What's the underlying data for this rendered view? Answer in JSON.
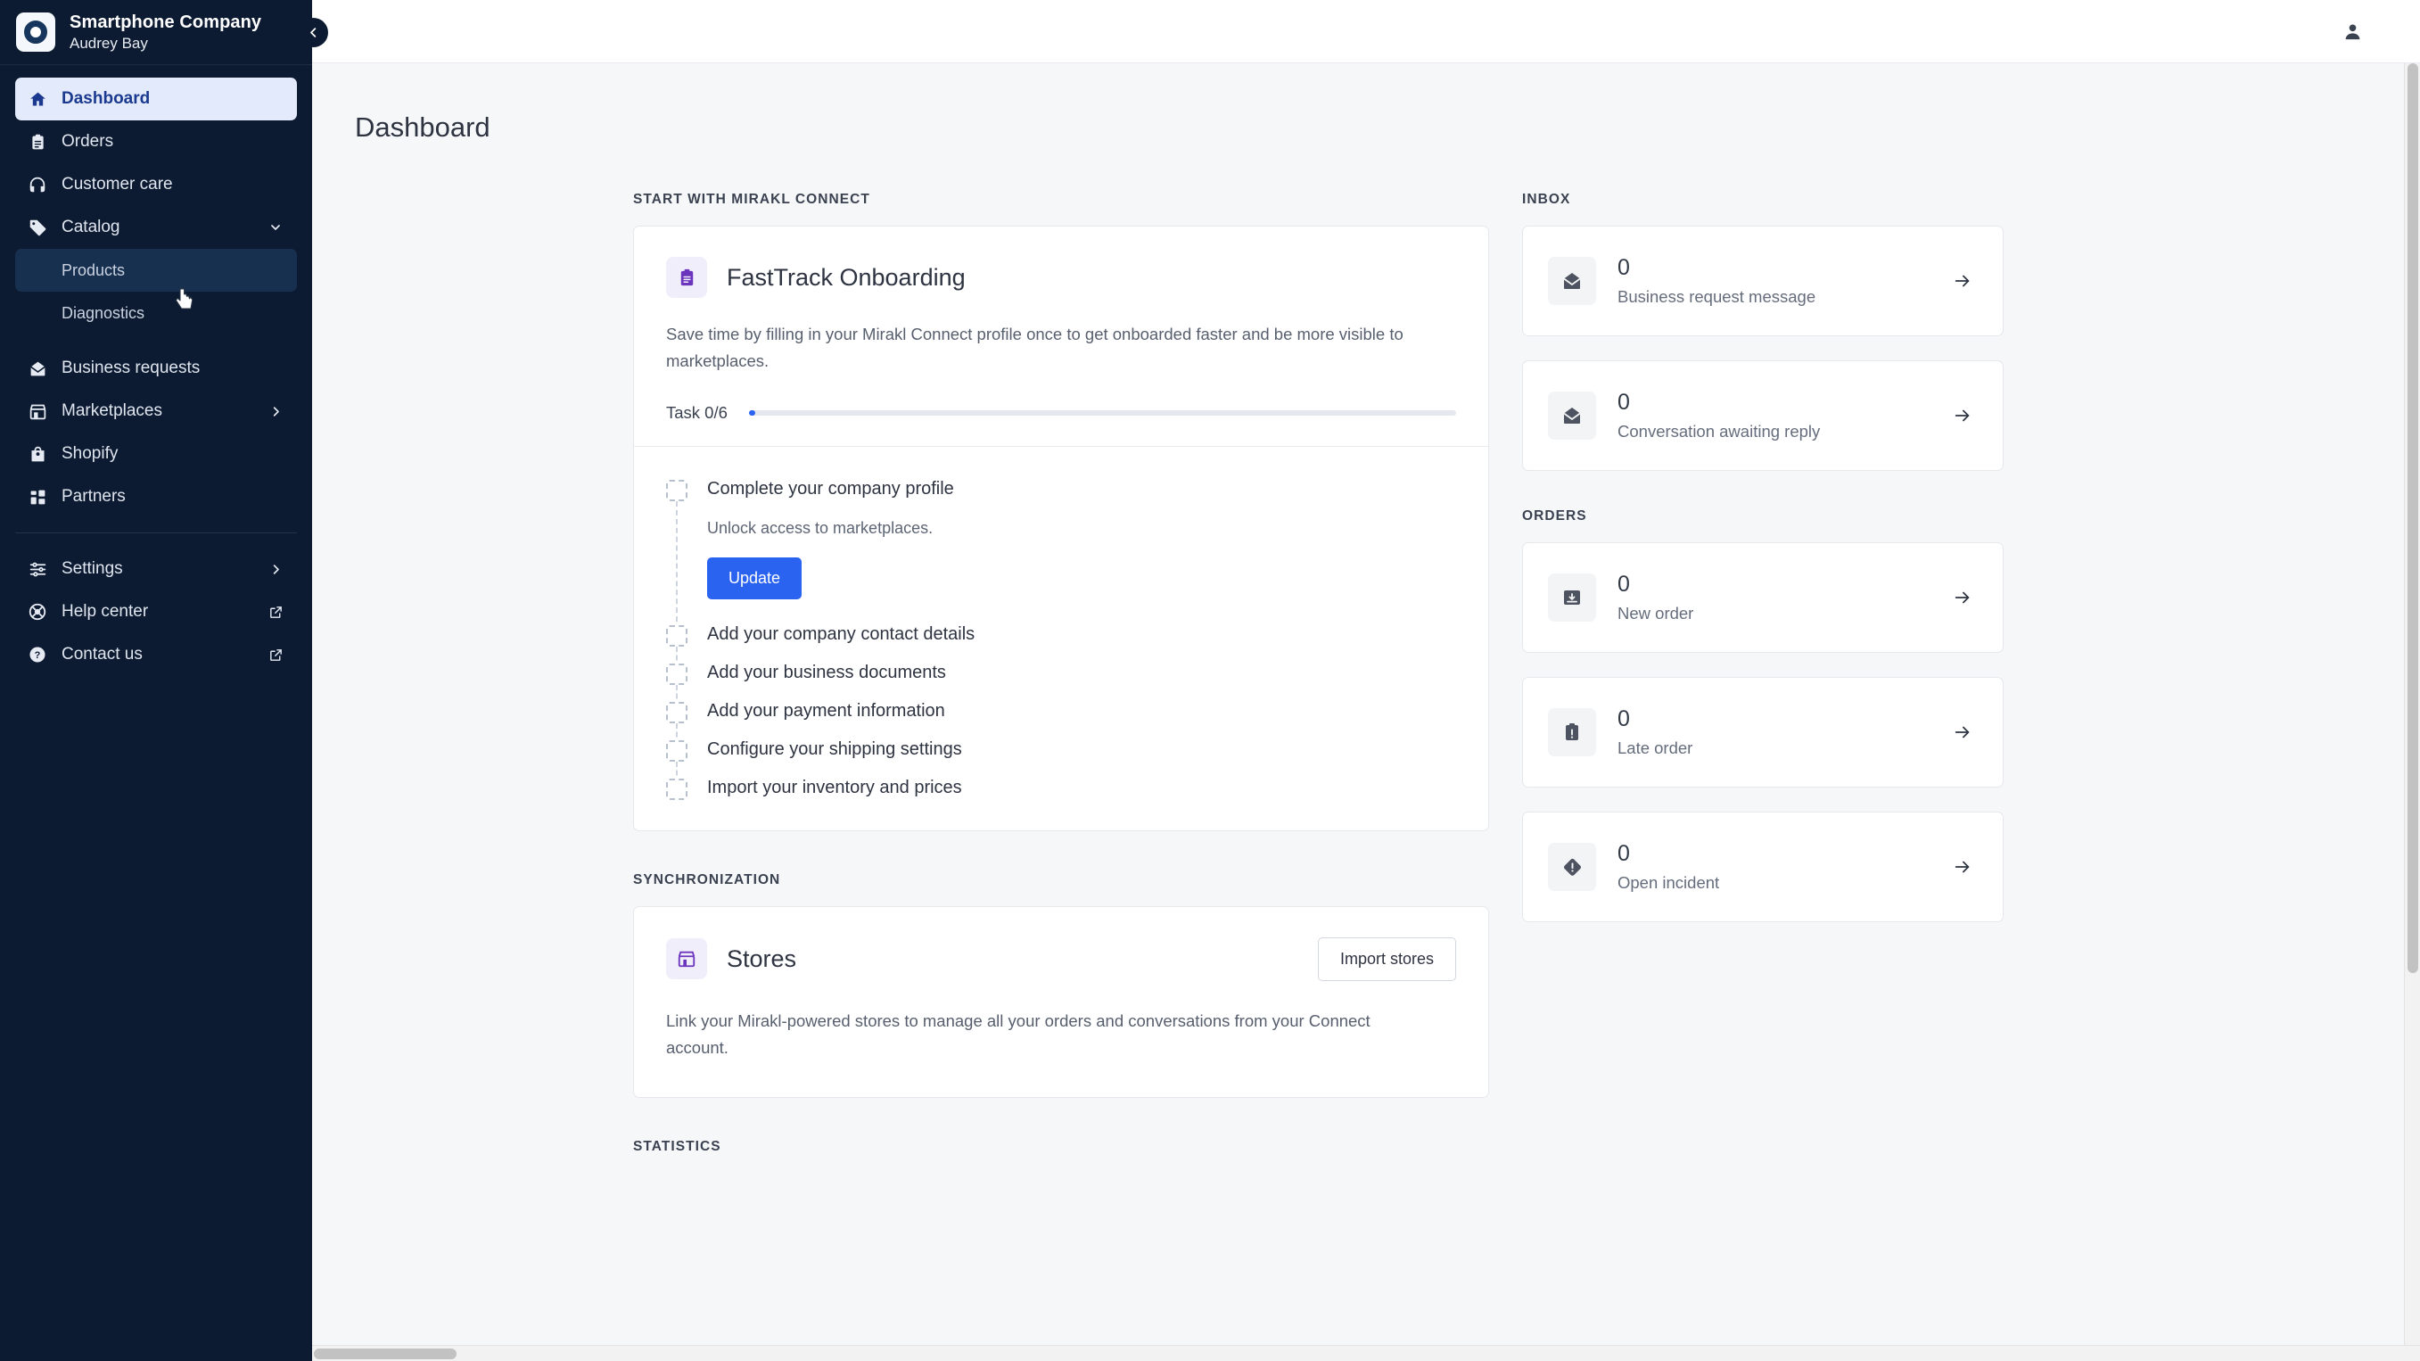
{
  "sidebar": {
    "brand": {
      "name": "Smartphone Company",
      "user": "Audrey Bay",
      "logo_icon": "ring-logo-icon"
    },
    "collapse_label": "‹",
    "items": [
      {
        "label": "Dashboard",
        "icon": "home-icon",
        "state": "active"
      },
      {
        "label": "Orders",
        "icon": "clipboard-icon",
        "state": "normal"
      },
      {
        "label": "Customer care",
        "icon": "headset-icon",
        "state": "normal"
      },
      {
        "label": "Catalog",
        "icon": "tag-icon",
        "state": "expanded",
        "chevron": "chevron-down-icon"
      },
      {
        "label": "Products",
        "icon": "",
        "state": "sub-hovered"
      },
      {
        "label": "Diagnostics",
        "icon": "",
        "state": "sub"
      },
      {
        "label": "Business requests",
        "icon": "envelope-open-icon",
        "state": "normal"
      },
      {
        "label": "Marketplaces",
        "icon": "storefront-icon",
        "state": "normal",
        "chevron": "chevron-right-icon"
      },
      {
        "label": "Shopify",
        "icon": "shopping-bag-icon",
        "state": "normal"
      },
      {
        "label": "Partners",
        "icon": "grid-icon",
        "state": "normal"
      }
    ],
    "footer_items": [
      {
        "label": "Settings",
        "icon": "sliders-icon",
        "chevron": "chevron-right-icon"
      },
      {
        "label": "Help center",
        "icon": "lifebuoy-icon",
        "external": "external-link-icon"
      },
      {
        "label": "Contact us",
        "icon": "question-circle-icon",
        "external": "external-link-icon"
      }
    ]
  },
  "topbar": {
    "user_icon": "user-icon"
  },
  "page": {
    "title": "Dashboard"
  },
  "start_section": {
    "label": "Start with Mirakl Connect",
    "card": {
      "icon": "clipboard-purple-icon",
      "title": "FastTrack Onboarding",
      "description": "Save time by filling in your Mirakl Connect profile once to get onboarded faster and be more visible to marketplaces.",
      "progress_label": "Task 0/6",
      "progress_percent": 0,
      "tasks": [
        {
          "label": "Complete your company profile",
          "sub": "Unlock access to marketplaces.",
          "button": "Update",
          "done": false
        },
        {
          "label": "Add your company contact details",
          "done": false
        },
        {
          "label": "Add your business documents",
          "done": false
        },
        {
          "label": "Add your payment information",
          "done": false
        },
        {
          "label": "Configure your shipping settings",
          "done": false
        },
        {
          "label": "Import your inventory and prices",
          "done": false
        }
      ]
    }
  },
  "sync_section": {
    "label": "Synchronization",
    "card": {
      "icon": "storefront-purple-icon",
      "title": "Stores",
      "action_label": "Import stores",
      "description": "Link your Mirakl-powered stores to manage all your orders and conversations from your Connect account."
    }
  },
  "statistics_section": {
    "label": "Statistics"
  },
  "inbox_section": {
    "label": "Inbox",
    "cards": [
      {
        "count": "0",
        "label": "Business request message",
        "icon": "envelope-open-icon",
        "arrow": "arrow-right-icon"
      },
      {
        "count": "0",
        "label": "Conversation awaiting reply",
        "icon": "envelope-open-icon",
        "arrow": "arrow-right-icon"
      }
    ]
  },
  "orders_section": {
    "label": "Orders",
    "cards": [
      {
        "count": "0",
        "label": "New order",
        "icon": "inbox-download-icon",
        "arrow": "arrow-right-icon"
      },
      {
        "count": "0",
        "label": "Late order",
        "icon": "clipboard-alert-icon",
        "arrow": "arrow-right-icon"
      },
      {
        "count": "0",
        "label": "Open incident",
        "icon": "diamond-alert-icon",
        "arrow": "arrow-right-icon"
      }
    ]
  },
  "colors": {
    "sidebar_bg": "#0d1b32",
    "accent_blue": "#2b63f1",
    "active_item_bg": "#e3eafb",
    "active_item_text": "#1b3a8f",
    "purple_icon": "#6b35bd",
    "page_bg": "#f6f7f9"
  }
}
